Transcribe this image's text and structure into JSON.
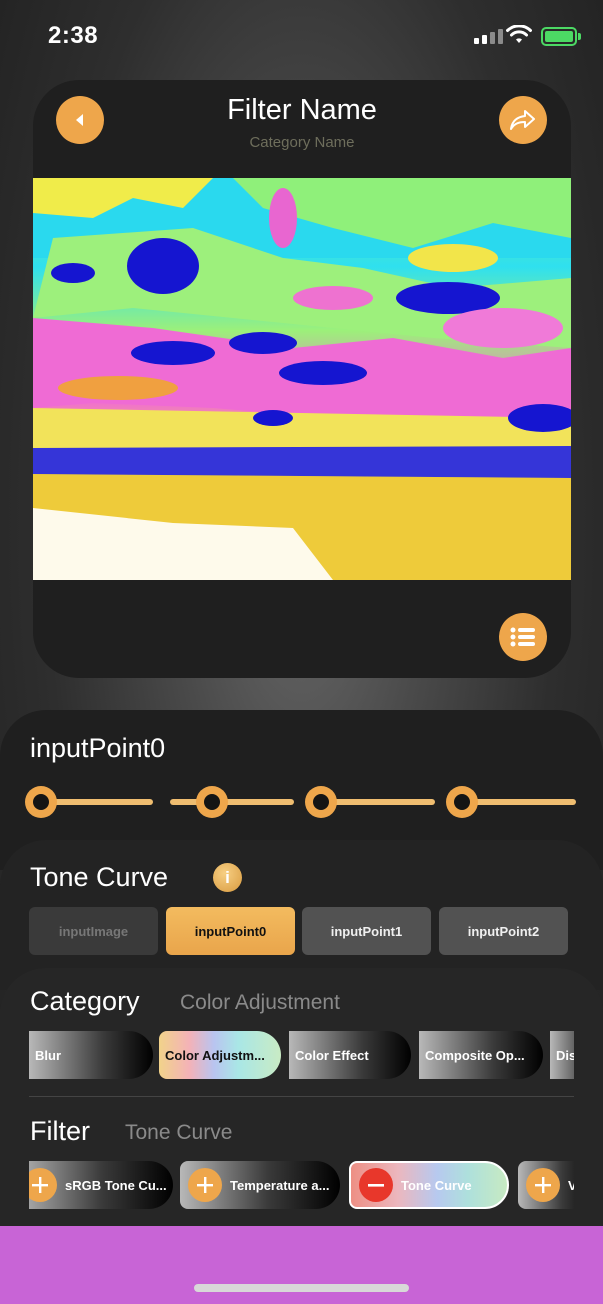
{
  "status_bar": {
    "time": "2:38"
  },
  "header": {
    "title": "Filter Name",
    "category": "Category Name"
  },
  "icons": {
    "back": "back-arrow-icon",
    "share": "share-icon",
    "menu": "list-icon",
    "info": "info-icon"
  },
  "input_panel": {
    "label": "inputPoint0",
    "sliders": [
      0.0,
      0.35,
      0.0,
      0.0
    ]
  },
  "tone_panel": {
    "title": "Tone Curve",
    "info_glyph": "i",
    "segments": [
      "inputImage",
      "inputPoint0",
      "inputPoint1",
      "inputPoint2"
    ],
    "selected_segment": "inputPoint0"
  },
  "category_panel": {
    "category_label": "Category",
    "category_value": "Color Adjustment",
    "categories": [
      "Blur",
      "Color Adjustm...",
      "Color Effect",
      "Composite Op...",
      "Dis"
    ],
    "filter_label": "Filter",
    "filter_value": "Tone Curve",
    "filters": [
      "sRGB Tone Cu...",
      "Temperature a...",
      "Tone Curve",
      "V"
    ]
  },
  "colors": {
    "accent": "#eea64b",
    "remove": "#e8372b",
    "bottom_bar": "#c864d6"
  }
}
